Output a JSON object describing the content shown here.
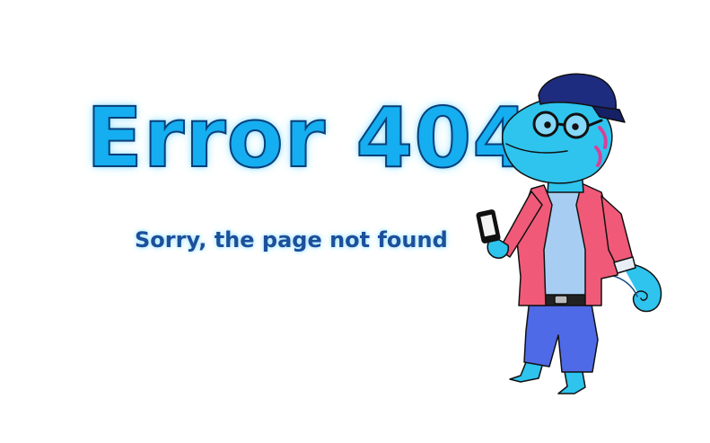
{
  "content": {
    "title": "Error 404",
    "subtitle": "Sorry, the page not found"
  },
  "mascot": {
    "icon": "chameleon-mascot-illustration"
  },
  "colors": {
    "title_fill": "#15aef0",
    "title_outline": "#0a3f7a",
    "subtitle": "#1d4f9a",
    "skin": "#2ec4ee",
    "jacket": "#f05a78",
    "shirt": "#a7cdf2",
    "pants": "#4f6ae6",
    "cap": "#1e2c80"
  }
}
